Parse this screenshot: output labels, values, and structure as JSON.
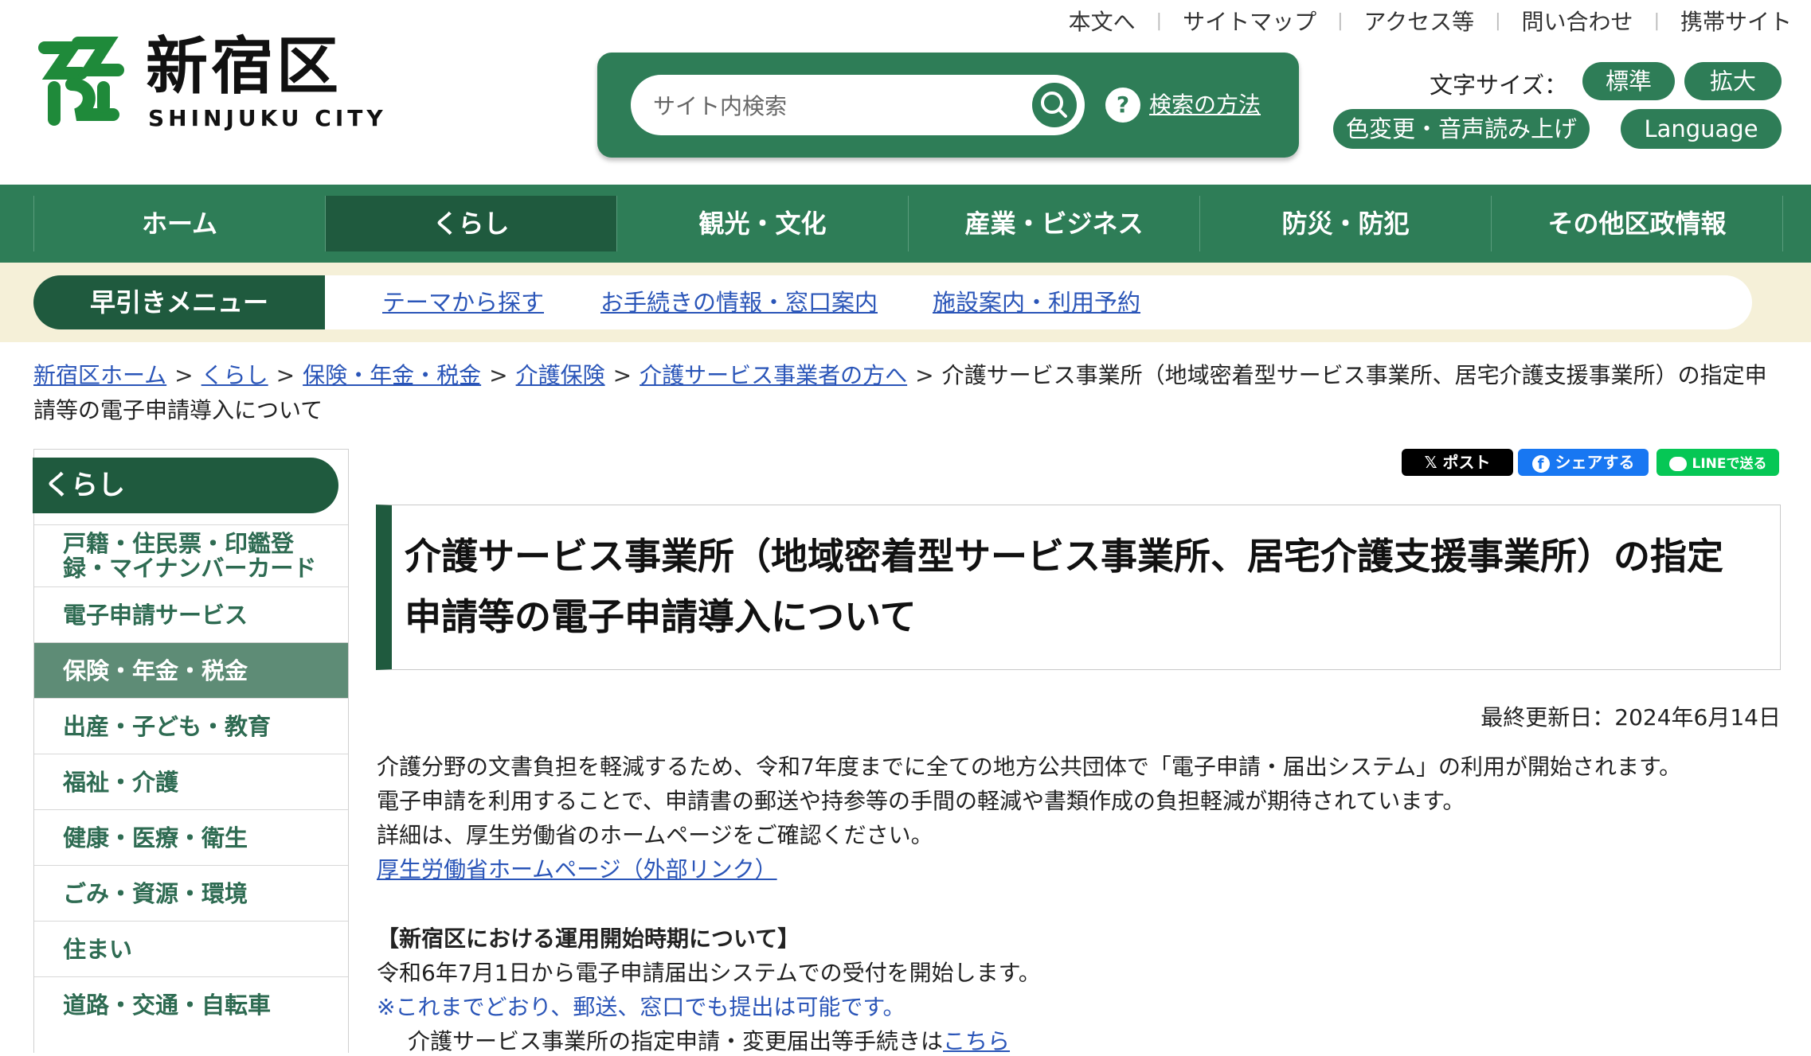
{
  "header": {
    "site_name": "新宿区",
    "site_name_en": "SHINJUKU CITY",
    "top_links": [
      "本文へ",
      "サイトマップ",
      "アクセス等",
      "問い合わせ",
      "携帯サイト"
    ],
    "search": {
      "placeholder": "サイト内検索",
      "help_label": "検索の方法",
      "help_icon": "?"
    },
    "font_size_label": "文字サイズ：",
    "font_size_buttons": {
      "standard": "標準",
      "enlarge": "拡大"
    },
    "color_button": "色変更・音声読み上げ",
    "language_button": "Language"
  },
  "global_nav": {
    "items": [
      "ホーム",
      "くらし",
      "観光・文化",
      "産業・ビジネス",
      "防災・防犯",
      "その他区政情報"
    ],
    "active": "くらし"
  },
  "quick_menu": {
    "label": "早引きメニュー",
    "links": [
      "テーマから探す",
      "お手続きの情報・窓口案内",
      "施設案内・利用予約"
    ]
  },
  "breadcrumb": {
    "links": [
      "新宿区ホーム",
      "くらし",
      "保険・年金・税金",
      "介護保険",
      "介護サービス事業者の方へ"
    ],
    "separator": ">",
    "current": "介護サービス事業所（地域密着型サービス事業所、居宅介護支援事業所）の指定申請等の電子申請導入について"
  },
  "sidebar": {
    "heading": "くらし",
    "items": [
      {
        "label": "戸籍・住民票・印鑑登録・マイナンバーカード"
      },
      {
        "label": "電子申請サービス"
      },
      {
        "label": "保険・年金・税金"
      },
      {
        "label": "出産・子ども・教育"
      },
      {
        "label": "福祉・介護"
      },
      {
        "label": "健康・医療・衛生"
      },
      {
        "label": "ごみ・資源・環境"
      },
      {
        "label": "住まい"
      },
      {
        "label": "道路・交通・自転車"
      }
    ],
    "active": "保険・年金・税金"
  },
  "share": {
    "x": "ポスト",
    "facebook": "シェアする",
    "line": "LINEで送る"
  },
  "main": {
    "title": "介護サービス事業所（地域密着型サービス事業所、居宅介護支援事業所）の指定申請等の電子申請導入について",
    "updated": "最終更新日：2024年6月14日",
    "paragraphs": [
      "介護分野の文書負担を軽減するため、令和7年度までに全ての地方公共団体で「電子申請・届出システム」の利用が開始されます。",
      "電子申請を利用することで、申請書の郵送や持参等の手間の軽減や書類作成の負担軽減が期待されています。",
      "詳細は、厚生労働省のホームページをご確認ください。"
    ],
    "external_link": "厚生労働省ホームページ（外部リンク）",
    "section_heading": "【新宿区における運用開始時期について】",
    "start_text": "令和6年7月1日から電子申請届出システムでの受付を開始します。",
    "note_text": "※これまでどおり、郵送、窓口でも提出は可能です。",
    "procedure_text": "介護サービス事業所の指定申請・変更届出等手続きは",
    "procedure_link": "こちら"
  },
  "colors": {
    "primary_green": "#2e7d57",
    "dark_green": "#1f5a3e",
    "quick_bg": "#f5f0d8",
    "link_blue": "#2a55b8"
  }
}
